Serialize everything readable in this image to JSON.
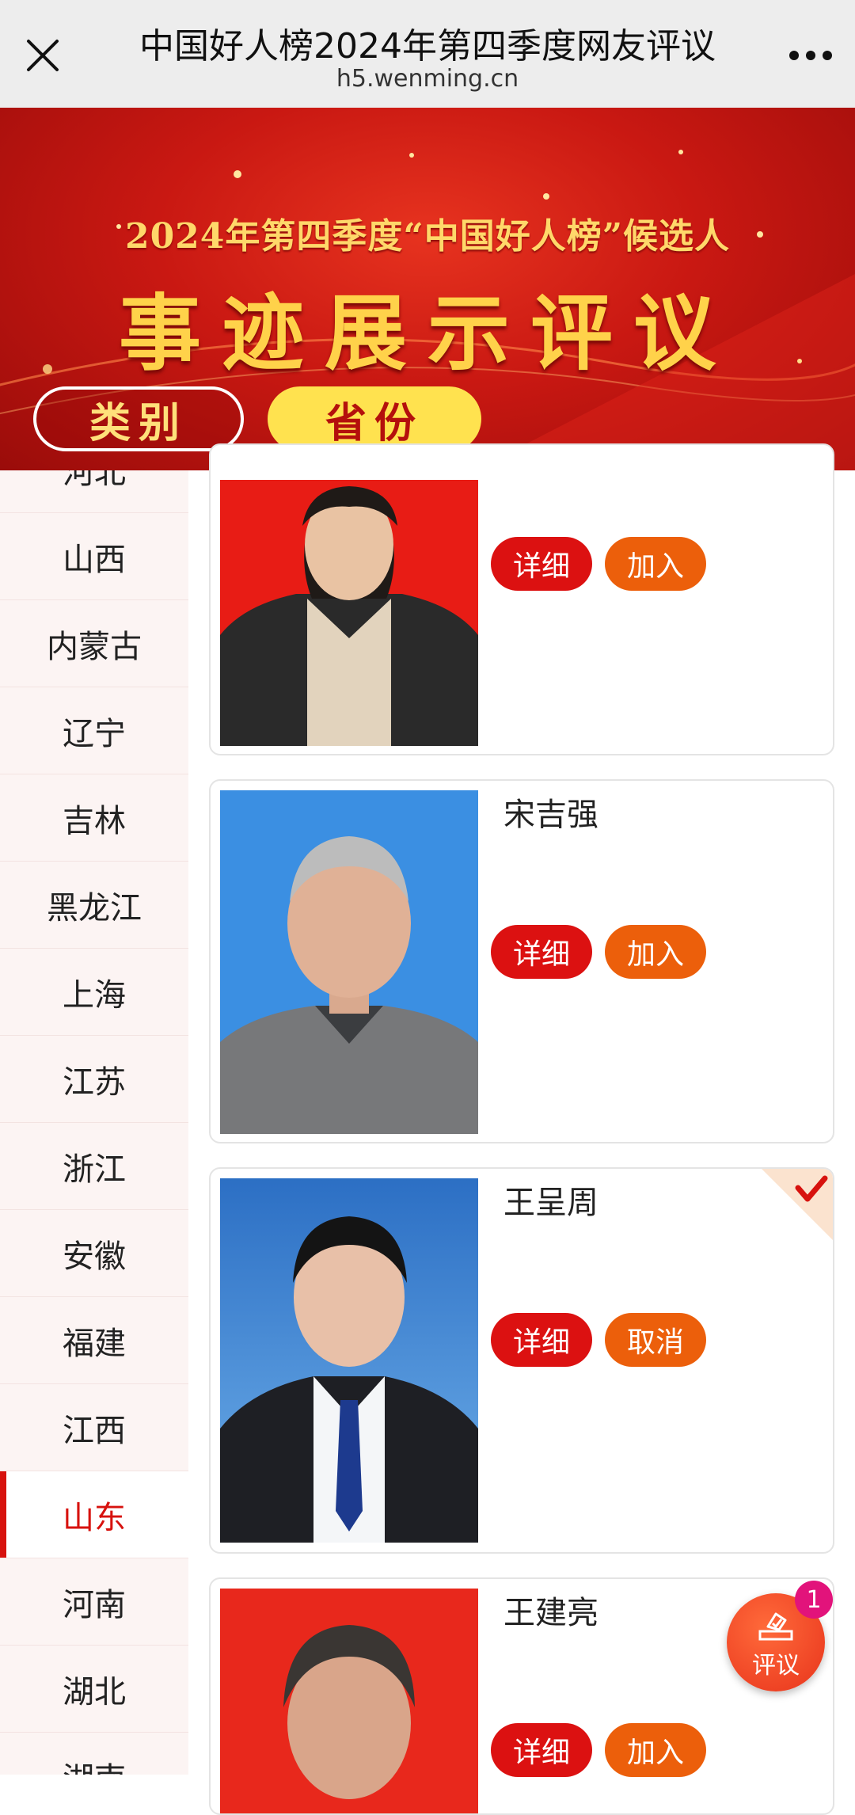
{
  "window": {
    "title": "中国好人榜2024年第四季度网友评议",
    "url": "h5.wenming.cn"
  },
  "banner": {
    "subtitle": "2024年第四季度“中国好人榜”候选人",
    "title": "事迹展示评议",
    "filters": [
      "类别",
      "省份"
    ],
    "selected_filter": "省份"
  },
  "sidebar": {
    "items": [
      "河北",
      "山西",
      "内蒙古",
      "辽宁",
      "吉林",
      "黑龙江",
      "上海",
      "江苏",
      "浙江",
      "安徽",
      "福建",
      "江西",
      "山东",
      "河南",
      "湖北",
      "湖南"
    ],
    "active": "山东"
  },
  "candidates": [
    {
      "name": "",
      "detail_label": "详细",
      "action_label": "加入",
      "selected": false
    },
    {
      "name": "宋吉强",
      "detail_label": "详细",
      "action_label": "加入",
      "selected": false
    },
    {
      "name": "王呈周",
      "detail_label": "详细",
      "action_label": "取消",
      "selected": true
    },
    {
      "name": "王建亮",
      "detail_label": "详细",
      "action_label": "加入",
      "selected": false
    }
  ],
  "review_fab": {
    "label": "评议",
    "badge_count": "1"
  },
  "colors": {
    "accent_red": "#d7120e",
    "detail_button": "#dc1111",
    "action_button": "#ec5f0b",
    "filter_yellow": "#ffe24f",
    "badge_pink": "#e2137b"
  }
}
